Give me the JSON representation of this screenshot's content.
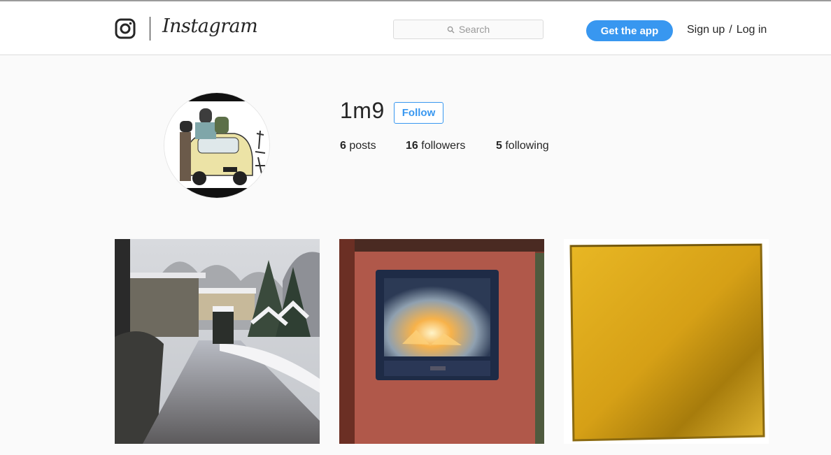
{
  "header": {
    "brand": "Instagram",
    "search_placeholder": "Search",
    "get_app_label": "Get the app",
    "signup_label": "Sign up",
    "separator": "/",
    "login_label": "Log in"
  },
  "profile": {
    "username": "1m9",
    "follow_label": "Follow",
    "stats": {
      "posts_count": "6",
      "posts_label": "posts",
      "followers_count": "16",
      "followers_label": "followers",
      "following_count": "5",
      "following_label": "following"
    },
    "avatar_icon": "cartoon-car-avatar"
  },
  "posts": [
    {
      "icon": "snowy-garden-photo"
    },
    {
      "icon": "fireplace-photo"
    },
    {
      "icon": "yellow-texture-photo"
    }
  ]
}
